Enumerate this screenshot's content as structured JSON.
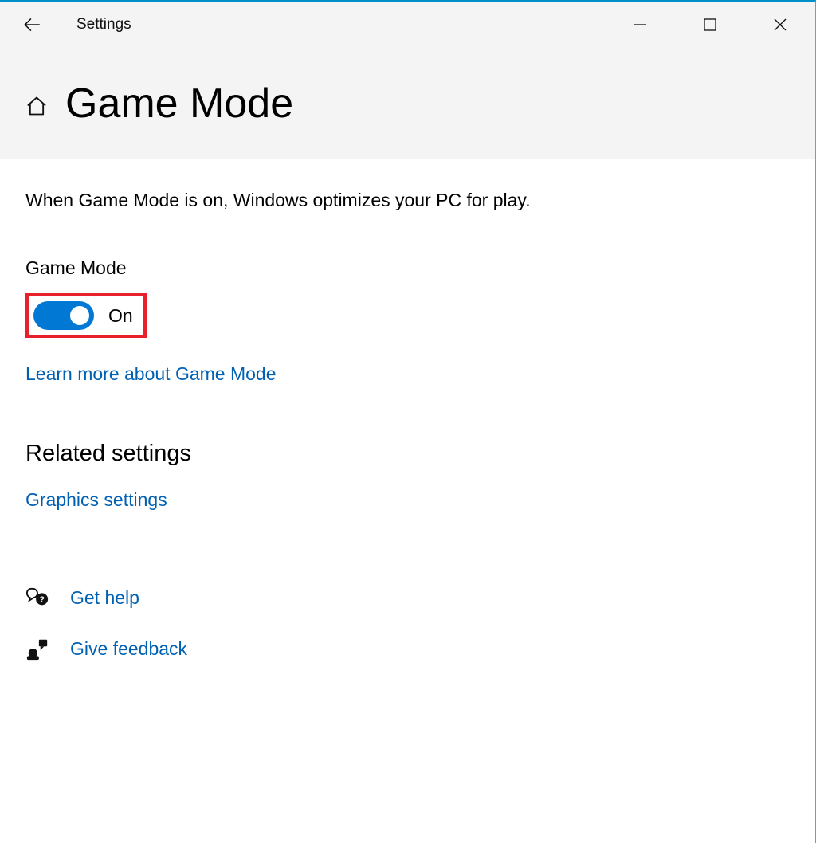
{
  "titlebar": {
    "app_title": "Settings"
  },
  "header": {
    "page_title": "Game Mode"
  },
  "main": {
    "description": "When Game Mode is on, Windows optimizes your PC for play.",
    "toggle_label": "Game Mode",
    "toggle_state": "On",
    "learn_more": "Learn more about Game Mode",
    "related_heading": "Related settings",
    "graphics_link": "Graphics settings",
    "get_help": "Get help",
    "give_feedback": "Give feedback"
  },
  "colors": {
    "accent": "#0078d4",
    "link": "#0061b3",
    "highlight": "#e8202a",
    "titlebar_border": "#0090c8"
  }
}
